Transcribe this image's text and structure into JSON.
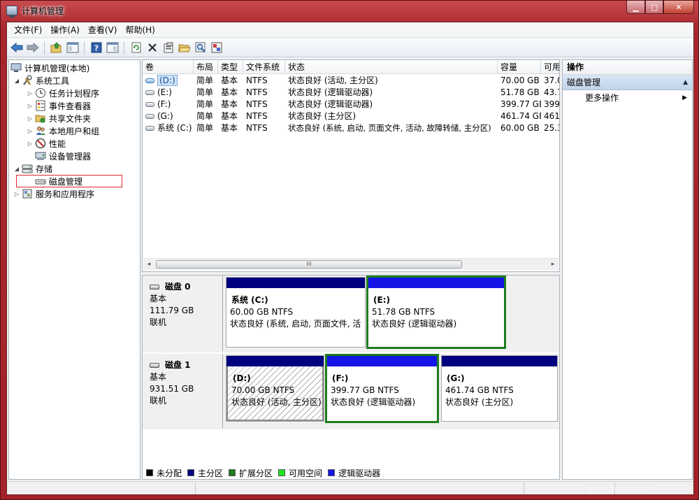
{
  "window": {
    "title": "计算机管理",
    "min_glyph": "▁",
    "max_glyph": "□",
    "close_glyph": "✕"
  },
  "menu": [
    "文件(F)",
    "操作(A)",
    "查看(V)",
    "帮助(H)"
  ],
  "toolbar": {
    "icons": [
      "back-arrow-icon",
      "forward-arrow-icon",
      "up-folder-icon",
      "show-hide-console-tree-icon",
      "help-icon",
      "show-hide-action-pane-icon",
      "refresh-icon",
      "delete-icon",
      "properties-icon",
      "open-folder-icon",
      "search-icon",
      "settings-icon"
    ]
  },
  "tree": {
    "root": "计算机管理(本地)",
    "system_tools": "系统工具",
    "task_scheduler": "任务计划程序",
    "event_viewer": "事件查看器",
    "shared_folders": "共享文件夹",
    "local_users": "本地用户和组",
    "performance": "性能",
    "device_manager": "设备管理器",
    "storage": "存储",
    "disk_management": "磁盘管理",
    "services_apps": "服务和应用程序"
  },
  "volume_list": {
    "headers": [
      "卷",
      "布局",
      "类型",
      "文件系统",
      "状态",
      "容量",
      "可用"
    ],
    "rows": [
      {
        "vol": "(D:)",
        "layout": "简单",
        "type": "基本",
        "fs": "NTFS",
        "status": "状态良好 (活动, 主分区)",
        "capacity": "70.00 GB",
        "free": "37.0"
      },
      {
        "vol": "(E:)",
        "layout": "简单",
        "type": "基本",
        "fs": "NTFS",
        "status": "状态良好 (逻辑驱动器)",
        "capacity": "51.78 GB",
        "free": "43.7"
      },
      {
        "vol": "(F:)",
        "layout": "简单",
        "type": "基本",
        "fs": "NTFS",
        "status": "状态良好 (逻辑驱动器)",
        "capacity": "399.77 GB",
        "free": "399"
      },
      {
        "vol": "(G:)",
        "layout": "简单",
        "type": "基本",
        "fs": "NTFS",
        "status": "状态良好 (主分区)",
        "capacity": "461.74 GB",
        "free": "461"
      },
      {
        "vol": "系统 (C:)",
        "layout": "简单",
        "type": "基本",
        "fs": "NTFS",
        "status": "状态良好 (系统, 启动, 页面文件, 活动, 故障转储, 主分区)",
        "capacity": "60.00 GB",
        "free": "25.3"
      }
    ],
    "scroll_thumb": "III",
    "scroll_left": "◂",
    "scroll_right": "▸"
  },
  "disks": [
    {
      "name": "磁盘 0",
      "type": "基本",
      "size": "111.79 GB",
      "state": "联机",
      "partitions": [
        {
          "name": "系统  (C:)",
          "size": "60.00 GB NTFS",
          "status": "状态良好 (系统, 启动, 页面文件, 活"
        },
        {
          "name": "(E:)",
          "size": "51.78 GB NTFS",
          "status": "状态良好 (逻辑驱动器)"
        }
      ]
    },
    {
      "name": "磁盘 1",
      "type": "基本",
      "size": "931.51 GB",
      "state": "联机",
      "partitions": [
        {
          "name": "(D:)",
          "size": "70.00 GB NTFS",
          "status": "状态良好 (活动, 主分区)"
        },
        {
          "name": "(F:)",
          "size": "399.77 GB NTFS",
          "status": "状态良好 (逻辑驱动器)"
        },
        {
          "name": "(G:)",
          "size": "461.74 GB NTFS",
          "status": "状态良好 (主分区)"
        }
      ]
    }
  ],
  "legend": [
    {
      "label": "未分配",
      "color": "#000000"
    },
    {
      "label": "主分区",
      "color": "#00007f"
    },
    {
      "label": "扩展分区",
      "color": "#1e7c1e"
    },
    {
      "label": "可用空间",
      "color": "#22e622"
    },
    {
      "label": "逻辑驱动器",
      "color": "#1414e6"
    }
  ],
  "actions": {
    "header": "操作",
    "section": "磁盘管理",
    "more": "更多操作",
    "section_arrow": "▲",
    "more_arrow": "▶"
  },
  "colors": {
    "primary_partition": "#00007f",
    "logical_drive": "#1414e6",
    "extended_selected": "#1e7c1e"
  },
  "watermark": {
    "text": "Bai 经验",
    "sub": "jingyan.baidu.com"
  }
}
